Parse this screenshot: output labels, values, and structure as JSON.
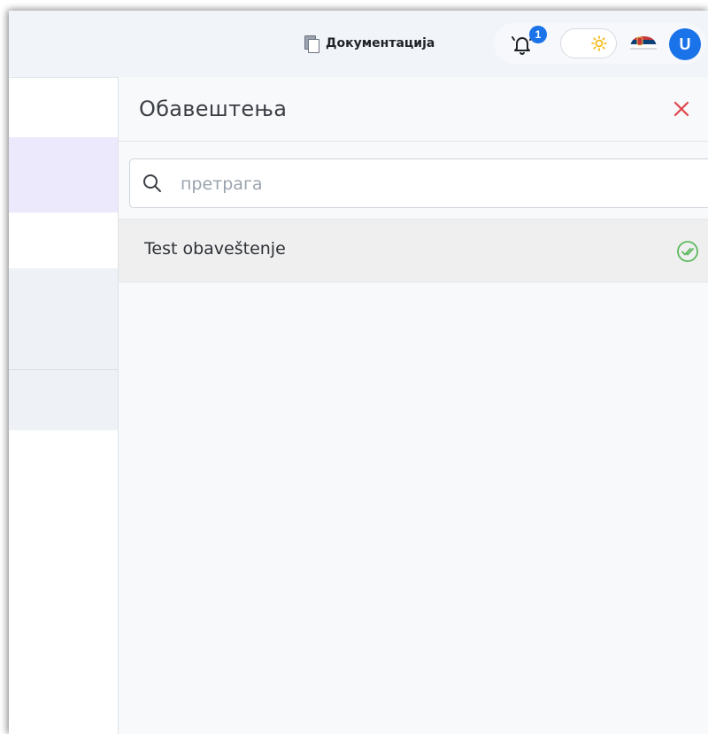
{
  "header": {
    "documentation_label": "Документација",
    "notification_count": "1",
    "avatar_initial": "U"
  },
  "colors": {
    "accent": "#1a73e8",
    "close": "#e0474c",
    "read_check": "#5cb85c",
    "sun": "#f4b400"
  },
  "icons": {
    "documentation": "documents-icon",
    "bell": "bell-icon",
    "theme": "sun-icon",
    "language": "serbian-flag-icon",
    "close": "close-icon",
    "search": "search-icon",
    "read": "double-check-icon"
  },
  "panel": {
    "title": "Обавештења",
    "search_placeholder": "претрага",
    "notifications": [
      {
        "title": "Test obaveštenje"
      }
    ]
  }
}
